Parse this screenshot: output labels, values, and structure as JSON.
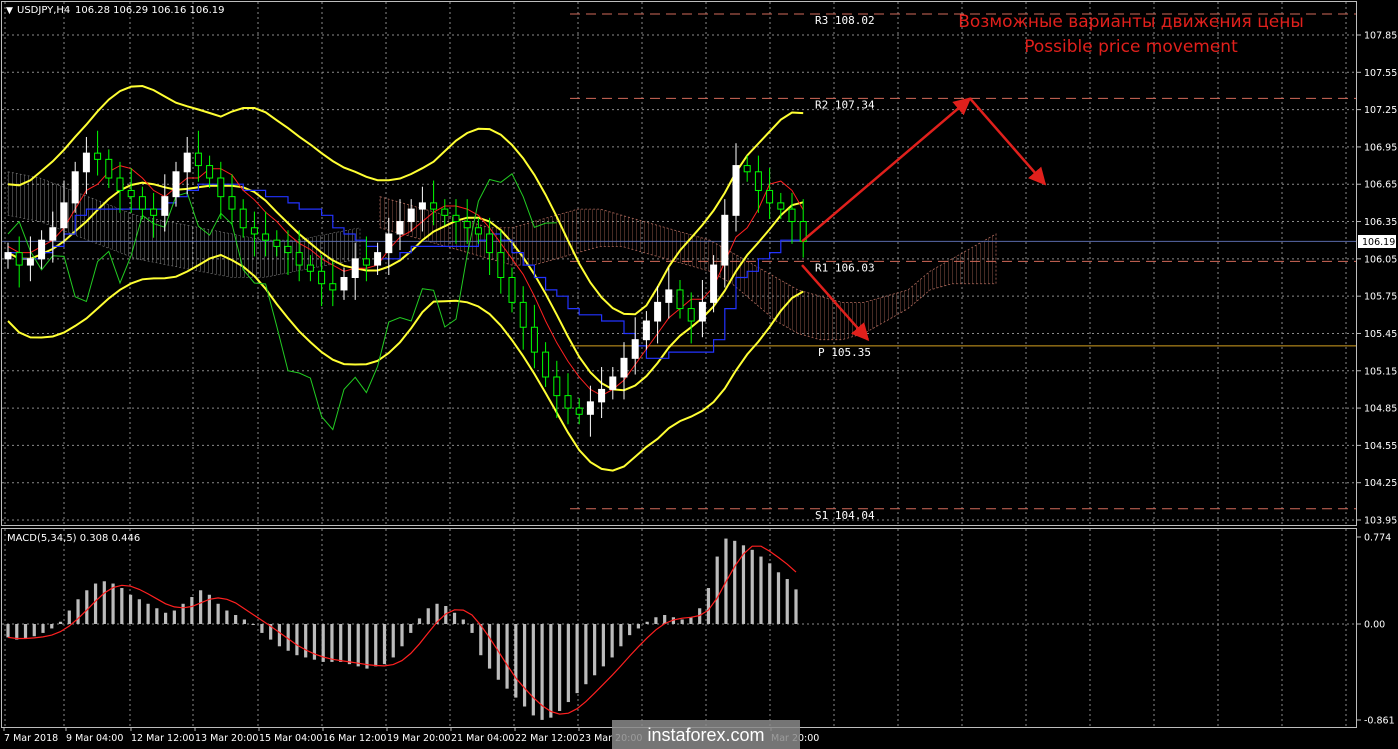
{
  "header": {
    "symbol": "USDJPY,H4",
    "ohlc": "106.28 106.29 106.16 106.19",
    "macd_label": "MACD(5,34,5) 0.308 0.446"
  },
  "annotation": {
    "line1": "Возможные варианты движения цены",
    "line2": "Possible price movement"
  },
  "watermark": "instaforex.com",
  "colors": {
    "bull": "#ffffff",
    "bear": "#00ff00",
    "bollinger": "#ffff33",
    "tenkan": "#ff2020",
    "kijun": "#2233ff",
    "chikou": "#22cc22",
    "pivot_line": "#d4a020",
    "level_line": "#d26a5a",
    "arrow": "#e0201c",
    "macd_hist": "#bcbcbc",
    "macd_signal": "#ff2020"
  },
  "chart_data": [
    {
      "type": "candlestick",
      "symbol": "USDJPY",
      "timeframe": "H4",
      "y_ticks": [
        "107.85",
        "107.55",
        "107.25",
        "106.95",
        "106.65",
        "106.35",
        "106.05",
        "105.75",
        "105.45",
        "105.15",
        "104.85",
        "104.55",
        "104.25",
        "103.95"
      ],
      "ylim": [
        103.95,
        108.0
      ],
      "current_price": "106.19",
      "x_ticks": [
        "7 Mar 2018",
        "9 Mar 04:00",
        "12 Mar 12:00",
        "13 Mar 20:00",
        "15 Mar 04:00",
        "16 Mar 12:00",
        "19 Mar 20:00",
        "21 Mar 04:00",
        "22 Mar 12:00",
        "23 Mar 20:00",
        "",
        "",
        "Mar 20:00"
      ],
      "pivots": [
        {
          "name": "R3",
          "label": "R3 108.02",
          "value": 108.02
        },
        {
          "name": "R2",
          "label": "R2 107.34",
          "value": 107.34
        },
        {
          "name": "R1",
          "label": "R1 106.03",
          "value": 106.03
        },
        {
          "name": "P",
          "label": "P 105.35",
          "value": 105.35
        },
        {
          "name": "S1",
          "label": "S1 104.04",
          "value": 104.04
        }
      ],
      "close_path": [
        106.1,
        106.0,
        106.05,
        106.2,
        106.3,
        106.5,
        106.75,
        106.9,
        106.85,
        106.7,
        106.6,
        106.55,
        106.45,
        106.4,
        106.55,
        106.75,
        106.9,
        106.8,
        106.7,
        106.55,
        106.45,
        106.3,
        106.25,
        106.2,
        106.15,
        106.1,
        106.0,
        105.95,
        105.85,
        105.8,
        105.9,
        106.05,
        106.0,
        106.1,
        106.25,
        106.35,
        106.45,
        106.5,
        106.45,
        106.4,
        106.35,
        106.3,
        106.25,
        106.1,
        105.9,
        105.7,
        105.5,
        105.3,
        105.1,
        104.95,
        104.85,
        104.8,
        104.9,
        105.0,
        105.1,
        105.25,
        105.4,
        105.55,
        105.7,
        105.8,
        105.65,
        105.55,
        105.7,
        106.0,
        106.4,
        106.8,
        106.75,
        106.6,
        106.5,
        106.45,
        106.35,
        106.19
      ],
      "forecast": [
        {
          "from": 106.19,
          "to": 107.34,
          "then": 106.65
        },
        {
          "from": 106.0,
          "to": 105.4
        }
      ]
    },
    {
      "type": "bar",
      "name": "MACD(5,34,5)",
      "y_ticks": [
        "0.774",
        "0.00",
        "-0.861"
      ],
      "ylim": [
        -0.861,
        0.774
      ],
      "values": [
        -0.12,
        -0.14,
        -0.13,
        -0.11,
        -0.08,
        -0.04,
        0.02,
        0.12,
        0.22,
        0.3,
        0.36,
        0.38,
        0.36,
        0.32,
        0.26,
        0.22,
        0.18,
        0.14,
        0.1,
        0.12,
        0.18,
        0.24,
        0.3,
        0.26,
        0.18,
        0.12,
        0.08,
        0.04,
        0.0,
        -0.08,
        -0.14,
        -0.2,
        -0.24,
        -0.28,
        -0.3,
        -0.32,
        -0.34,
        -0.34,
        -0.34,
        -0.36,
        -0.38,
        -0.4,
        -0.38,
        -0.36,
        -0.3,
        -0.2,
        -0.08,
        0.05,
        0.14,
        0.18,
        0.16,
        0.1,
        0.04,
        -0.08,
        -0.28,
        -0.4,
        -0.5,
        -0.58,
        -0.66,
        -0.74,
        -0.82,
        -0.86,
        -0.84,
        -0.78,
        -0.7,
        -0.62,
        -0.54,
        -0.46,
        -0.38,
        -0.3,
        -0.2,
        -0.1,
        -0.04,
        0.02,
        0.06,
        0.08,
        0.06,
        0.04,
        0.06,
        0.14,
        0.32,
        0.6,
        0.76,
        0.74,
        0.7,
        0.66,
        0.6,
        0.54,
        0.46,
        0.4,
        0.308
      ],
      "signal": 0.446
    }
  ]
}
